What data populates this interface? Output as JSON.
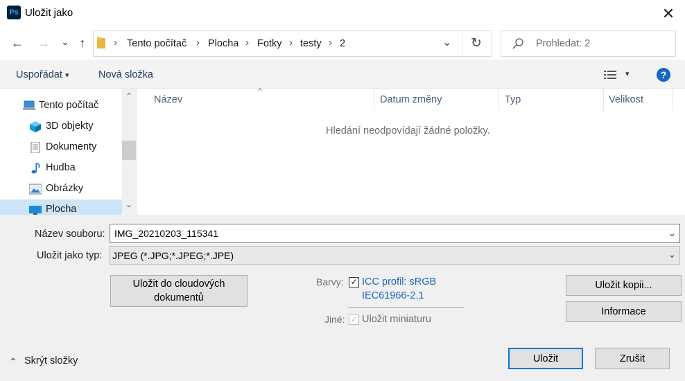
{
  "window": {
    "title": "Uložit jako",
    "app_icon_label": "Ps",
    "close_glyph": "✕"
  },
  "nav": {
    "back_glyph": "←",
    "forward_glyph": "→",
    "recent_glyph": "⌄",
    "up_glyph": "↑",
    "breadcrumb": [
      "Tento počítač",
      "Plocha",
      "Fotky",
      "testy",
      "2"
    ],
    "separator": "›",
    "dropdown_glyph": "⌄",
    "refresh_glyph": "↻",
    "search_placeholder": "Prohledat: 2"
  },
  "toolbar": {
    "organize_label": "Uspořádat",
    "organize_caret": "▾",
    "new_folder_label": "Nová složka",
    "view_caret": "▾",
    "help_label": "?"
  },
  "tree": [
    {
      "label": "Tento počítač",
      "icon": "computer-icon"
    },
    {
      "label": "3D objekty",
      "icon": "3d-objects-icon"
    },
    {
      "label": "Dokumenty",
      "icon": "documents-icon"
    },
    {
      "label": "Hudba",
      "icon": "music-icon"
    },
    {
      "label": "Obrázky",
      "icon": "pictures-icon"
    },
    {
      "label": "Plocha",
      "icon": "desktop-icon",
      "selected": true
    }
  ],
  "filelist": {
    "columns": [
      "Název",
      "Datum změny",
      "Typ",
      "Velikost"
    ],
    "sort_glyph": "^",
    "empty_message": "Hledání neodpovídají žádné položky."
  },
  "form": {
    "filename_label": "Název souboru:",
    "filename_value": "IMG_20210203_115341",
    "filetype_label": "Uložit jako typ:",
    "filetype_value": "JPEG (*.JPG;*.JPEG;*.JPE)",
    "cloud_button_line1": "Uložit do cloudových",
    "cloud_button_line2": "dokumentů",
    "colors_label": "Barvy:",
    "icc_line1": "ICC profil:  sRGB",
    "icc_line2": "IEC61966-2.1",
    "icc_checked": true,
    "other_label": "Jiné:",
    "thumbnail_label": "Uložit miniaturu",
    "thumbnail_checked": true,
    "save_copy_label": "Uložit kopii...",
    "info_label": "Informace",
    "hide_folders_label": "Skrýt složky",
    "hide_folders_glyph": "⌃",
    "save_label": "Uložit",
    "cancel_label": "Zrušit",
    "combo_arrow": "⌄",
    "check_glyph": "✓"
  },
  "colors": {
    "accent": "#0078d7",
    "selected_bg": "#cce4f7",
    "link": "#1a67c2"
  }
}
